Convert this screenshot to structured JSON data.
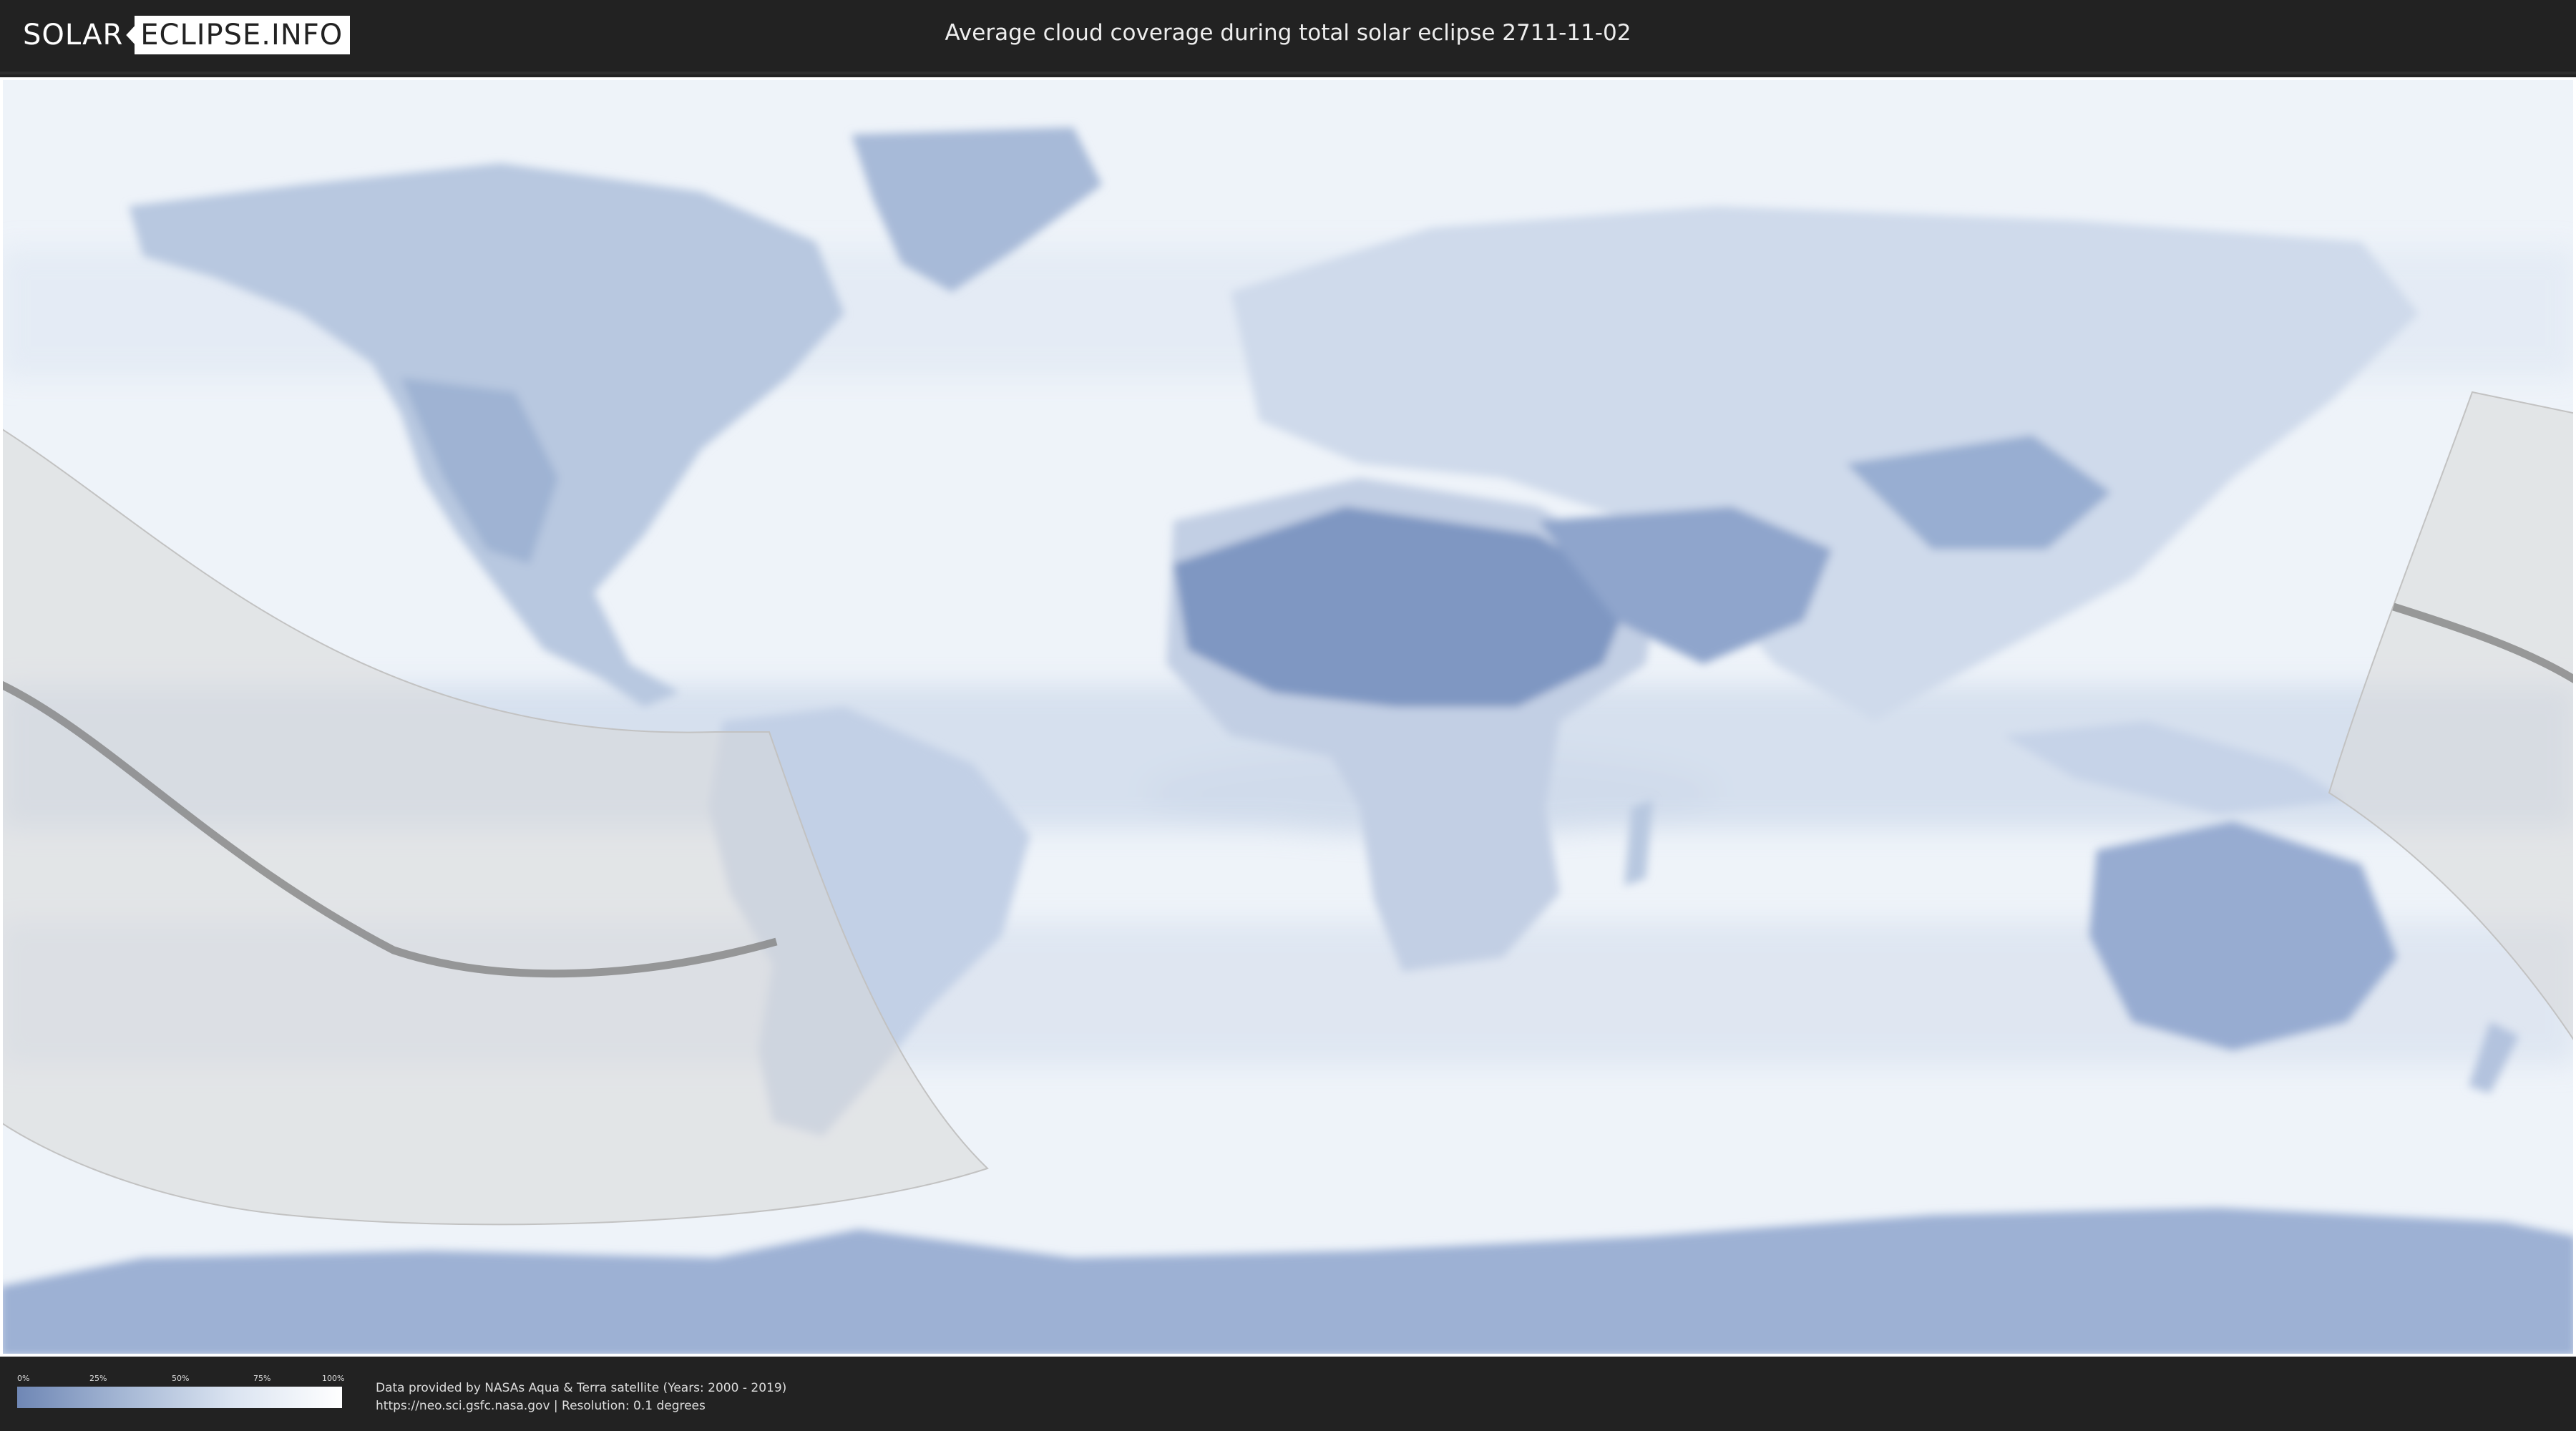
{
  "header": {
    "logo_part1": "SOLAR",
    "logo_part2": "ECLIPSE.INFO",
    "title": "Average cloud coverage during total solar eclipse 2711-11-02"
  },
  "map": {
    "ocean_cloud_color": "#eef3f9",
    "clear_sky_color": "#6f87b5",
    "eclipse_band_color": "#d8d8d8",
    "central_line_color": "#7d7d7d"
  },
  "legend": {
    "ticks": [
      "0%",
      "25%",
      "50%",
      "75%",
      "100%"
    ],
    "gradient_colors": [
      "#6f87b5",
      "#a6b8d5",
      "#dbe4f1",
      "#ffffff"
    ]
  },
  "credits": {
    "line1": "Data provided by NASAs Aqua & Terra satellite (Years: 2000 - 2019)",
    "line2": "https://neo.sci.gsfc.nasa.gov | Resolution: 0.1 degrees"
  }
}
